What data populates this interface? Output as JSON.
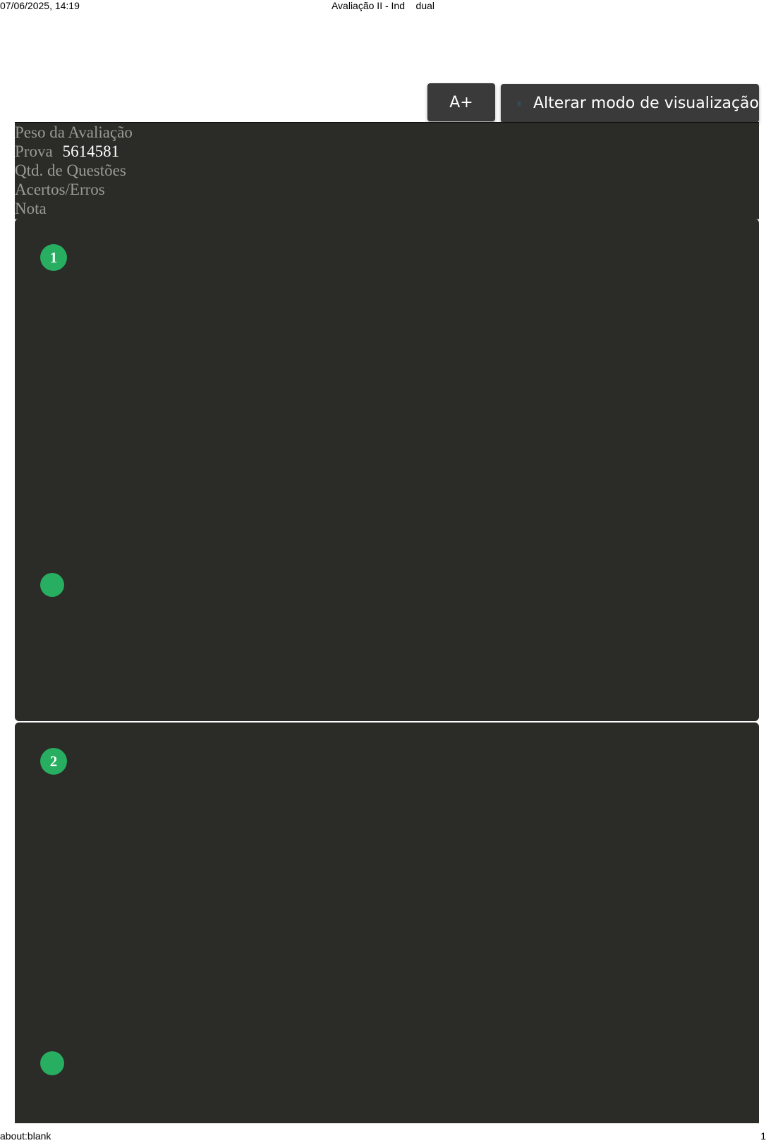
{
  "print_header": {
    "datetime": "07/06/2025, 14:19",
    "title": "Avaliação II - Ind    dual"
  },
  "toolbar": {
    "font_increase_label": "A+",
    "view_mode_label": "Alterar modo de visualização",
    "view_mode_icon": "document-icon",
    "accent_color": "#17a2b8"
  },
  "summary": {
    "weight_label": "Peso da Avaliação",
    "exam_label": "Prova",
    "exam_value": "5614581",
    "questions_label": "Qtd. de Questões",
    "score_label": "Acertos/Erros",
    "grade_label": "Nota"
  },
  "questions": [
    {
      "number": "1"
    },
    {
      "number": "2"
    }
  ],
  "status_color": "#27ae60",
  "print_footer": {
    "url": "about:blank",
    "page": "1"
  }
}
